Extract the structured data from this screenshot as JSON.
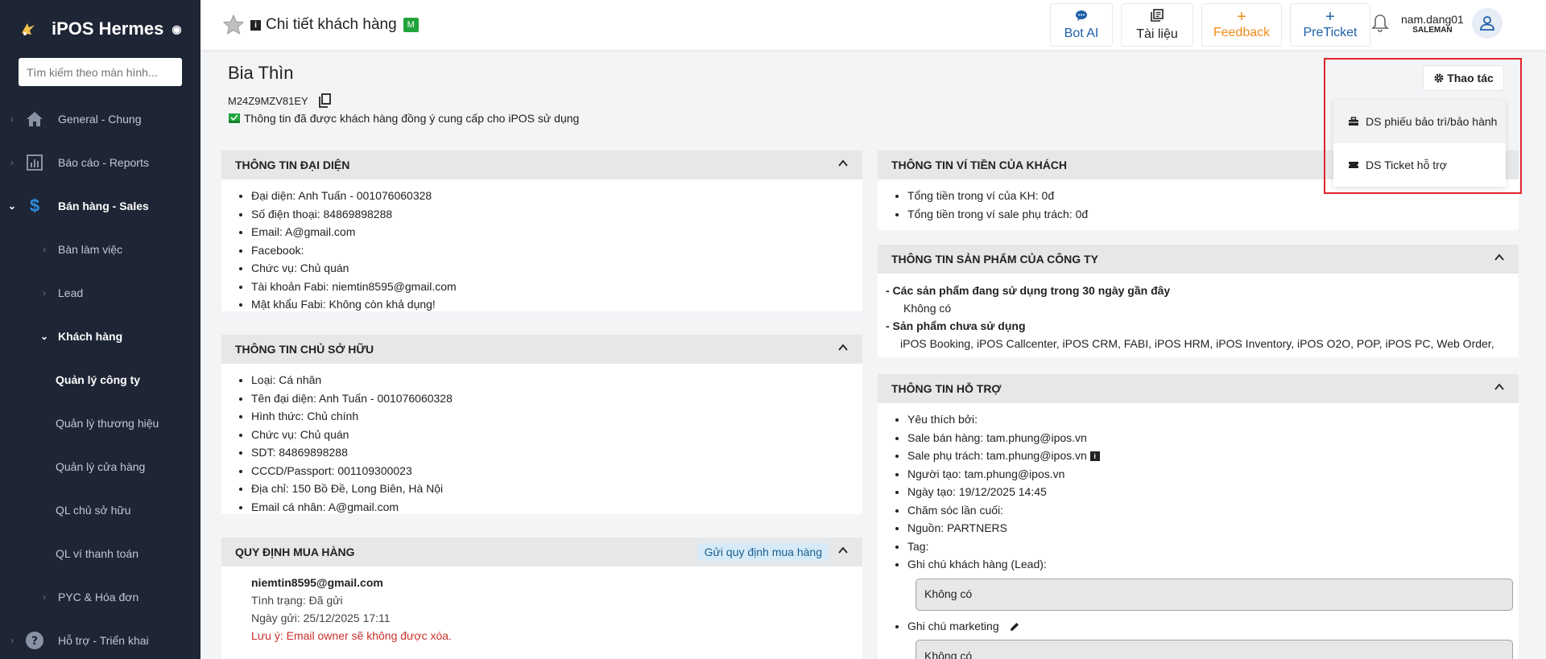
{
  "app": {
    "name": "iPOS Hermes"
  },
  "sidebar": {
    "search_placeholder": "Tìm kiếm theo màn hình...",
    "items": [
      {
        "label": "General - Chung"
      },
      {
        "label": "Báo cáo - Reports"
      },
      {
        "label": "Bán hàng - Sales"
      },
      {
        "label": "Bàn làm việc"
      },
      {
        "label": "Lead"
      },
      {
        "label": "Khách hàng"
      },
      {
        "label": "Quản lý công ty"
      },
      {
        "label": "Quản lý thương hiệu"
      },
      {
        "label": "Quản lý cửa hàng"
      },
      {
        "label": "QL chủ sở hữu"
      },
      {
        "label": "QL ví thanh toán"
      },
      {
        "label": "PYC & Hóa đơn"
      },
      {
        "label": "Hỗ trợ - Triển khai"
      }
    ]
  },
  "header": {
    "title": "Chi tiết khách hàng",
    "badge": "M",
    "buttons": [
      {
        "label": "Bot AI",
        "glyph": "💬",
        "color": "#1d5fa8"
      },
      {
        "label": "Tài liệu",
        "glyph": "📚",
        "color": "#222222"
      },
      {
        "label": "Feedback",
        "glyph": "+",
        "color": "#f28c1a"
      },
      {
        "label": "PreTicket",
        "glyph": "+",
        "color": "#1d5fa8"
      }
    ],
    "user": {
      "name": "nam.dang01",
      "role": "SALEMAN"
    }
  },
  "customer": {
    "name": "Bia Thìn",
    "code": "M24Z9MZV81EY",
    "consent": "Thông tin đã được khách hàng đồng ý cung cấp cho iPOS sử dụng"
  },
  "cards": {
    "representative": {
      "title": "THÔNG TIN ĐẠI DIỆN",
      "items": [
        "Đại diện: Anh Tuấn - 001076060328",
        "Số điện thoại: 84869898288",
        "Email: A@gmail.com",
        "Facebook:",
        "Chức vụ: Chủ quán",
        "Tài khoản Fabi: niemtin8595@gmail.com",
        "Mật khẩu Fabi: Không còn khả dụng!"
      ]
    },
    "owner": {
      "title": "THÔNG TIN CHỦ SỞ HỮU",
      "items": [
        "Loại: Cá nhân",
        "Tên đại diện: Anh Tuấn - 001076060328",
        "Hình thức: Chủ chính",
        "Chức vụ: Chủ quán",
        "SDT: 84869898288",
        "CCCD/Passport: 001109300023",
        "Địa chỉ: 150 Bồ Đề, Long Biên, Hà Nội",
        "Email cá nhân: A@gmail.com"
      ]
    },
    "purchase_rules": {
      "title": "QUY ĐỊNH MUA HÀNG",
      "send_button": "Gửi quy định mua hàng",
      "email": "niemtin8595@gmail.com",
      "status": "Tình trạng: Đã gửi",
      "sent_date": "Ngày gửi: 25/12/2025 17:11",
      "warning": "Lưu ý: Email owner sẽ không được xóa."
    },
    "wallet": {
      "title": "THÔNG TIN VÍ TIỀN CỦA KHÁCH",
      "items": [
        "Tổng tiền trong ví của KH: 0đ",
        "Tổng tiền trong ví sale phụ trách: 0đ"
      ]
    },
    "products": {
      "title": "THÔNG TIN SẢN PHẨM CỦA CÔNG TY",
      "used_title": "- Các sản phẩm đang sử dụng trong 30 ngày gần đây",
      "used_value": "Không có",
      "unused_title": "- Sản phẩm chưa sử dụng",
      "unused_value": "iPOS Booking, iPOS Callcenter, iPOS CRM, FABI, iPOS HRM, iPOS Inventory, iPOS O2O, POP, iPOS PC, Web Order,"
    },
    "support": {
      "title": "THÔNG TIN HỖ TRỢ",
      "items": [
        "Yêu thích bởi:",
        "Sale bán hàng: tam.phung@ipos.vn",
        "Sale phụ trách: tam.phung@ipos.vn",
        "Người tạo: tam.phung@ipos.vn",
        "Ngày tạo: 19/12/2025 14:45",
        "Chăm sóc lần cuối:",
        "Nguồn: PARTNERS",
        "Tag:",
        "Ghi chú khách hàng (Lead):"
      ],
      "lead_note": "Không có",
      "marketing_label": "Ghi chú marketing",
      "marketing_note": "Không có"
    }
  },
  "actions": {
    "button": "Thao tác",
    "menu": [
      {
        "label": "DS phiếu bảo trì/bảo hành"
      },
      {
        "label": "DS Ticket hỗ trợ"
      }
    ]
  }
}
